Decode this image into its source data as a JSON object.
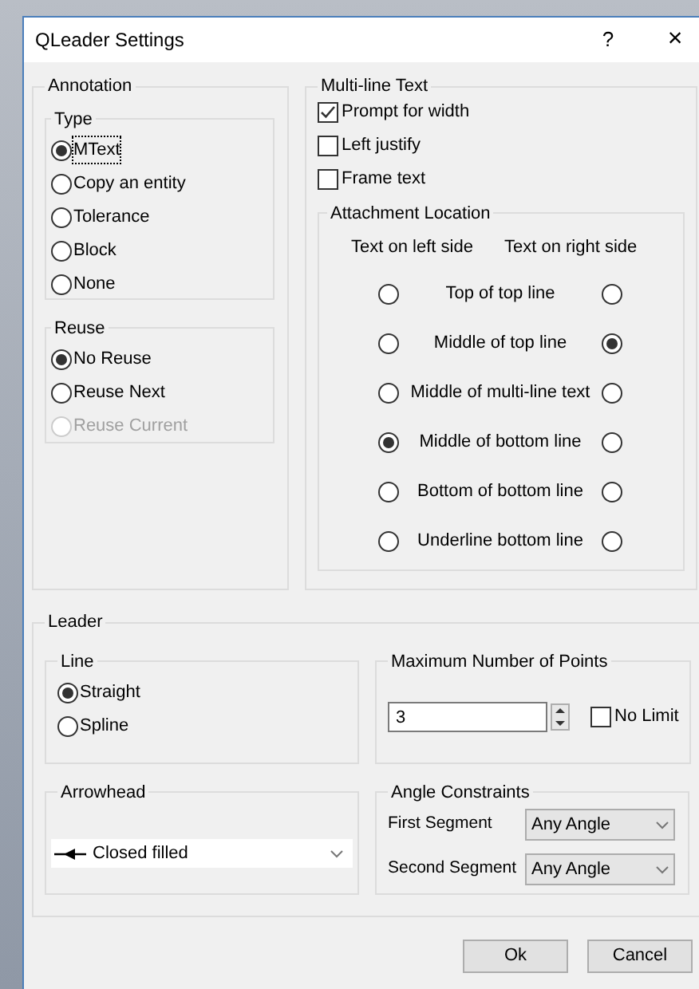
{
  "window": {
    "title": "QLeader Settings",
    "help_button": "?",
    "close_button": "×"
  },
  "annotation": {
    "title": "Annotation",
    "type": {
      "title": "Type",
      "options": [
        {
          "label": "MText",
          "selected": true,
          "focused": true
        },
        {
          "label": "Copy an entity",
          "selected": false,
          "focused": false
        },
        {
          "label": "Tolerance",
          "selected": false,
          "focused": false
        },
        {
          "label": "Block",
          "selected": false,
          "focused": false
        },
        {
          "label": "None",
          "selected": false,
          "focused": false
        }
      ]
    },
    "reuse": {
      "title": "Reuse",
      "options": [
        {
          "label": "No Reuse",
          "selected": true,
          "disabled": false
        },
        {
          "label": "Reuse Next",
          "selected": false,
          "disabled": false
        },
        {
          "label": "Reuse Current",
          "selected": false,
          "disabled": true
        }
      ]
    }
  },
  "multiline_text": {
    "title": "Multi-line Text",
    "checkboxes": [
      {
        "label": "Prompt for width",
        "checked": true
      },
      {
        "label": "Left justify",
        "checked": false
      },
      {
        "label": "Frame text",
        "checked": false
      }
    ],
    "attachment": {
      "title": "Attachment Location",
      "left_header": "Text on left side",
      "right_header": "Text on right side",
      "rows": [
        {
          "label": "Top of top line",
          "left_selected": false,
          "right_selected": false
        },
        {
          "label": "Middle of top line",
          "left_selected": false,
          "right_selected": true
        },
        {
          "label": "Middle of multi-line text",
          "left_selected": false,
          "right_selected": false
        },
        {
          "label": "Middle of bottom line",
          "left_selected": true,
          "right_selected": false
        },
        {
          "label": "Bottom of bottom line",
          "left_selected": false,
          "right_selected": false
        },
        {
          "label": "Underline bottom line",
          "left_selected": false,
          "right_selected": false
        }
      ]
    }
  },
  "leader": {
    "title": "Leader",
    "line": {
      "title": "Line",
      "options": [
        {
          "label": "Straight",
          "selected": true
        },
        {
          "label": "Spline",
          "selected": false
        }
      ]
    },
    "max_points": {
      "title": "Maximum Number of Points",
      "value": "3",
      "no_limit": {
        "label": "No Limit",
        "checked": false
      }
    },
    "arrowhead": {
      "title": "Arrowhead",
      "value": "Closed filled"
    },
    "angle_constraints": {
      "title": "Angle Constraints",
      "rows": [
        {
          "label": "First Segment",
          "value": "Any Angle"
        },
        {
          "label": "Second Segment",
          "value": "Any Angle"
        }
      ]
    }
  },
  "buttons": [
    {
      "label": "Ok"
    },
    {
      "label": "Cancel"
    }
  ]
}
